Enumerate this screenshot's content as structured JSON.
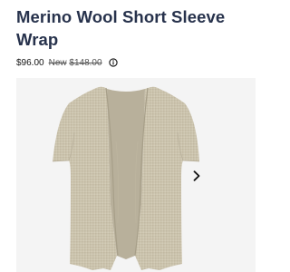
{
  "product": {
    "title": "Merino Wool Short Sleeve Wrap",
    "price": "$96.00",
    "compare_prefix": "New",
    "compare_price": "$148.00"
  },
  "icons": {
    "info": "info-icon",
    "next": "chevron-right-icon"
  },
  "colors": {
    "title": "#27324c",
    "garment": "#cbc3ad",
    "gallery_bg": "#f4f4f4"
  }
}
